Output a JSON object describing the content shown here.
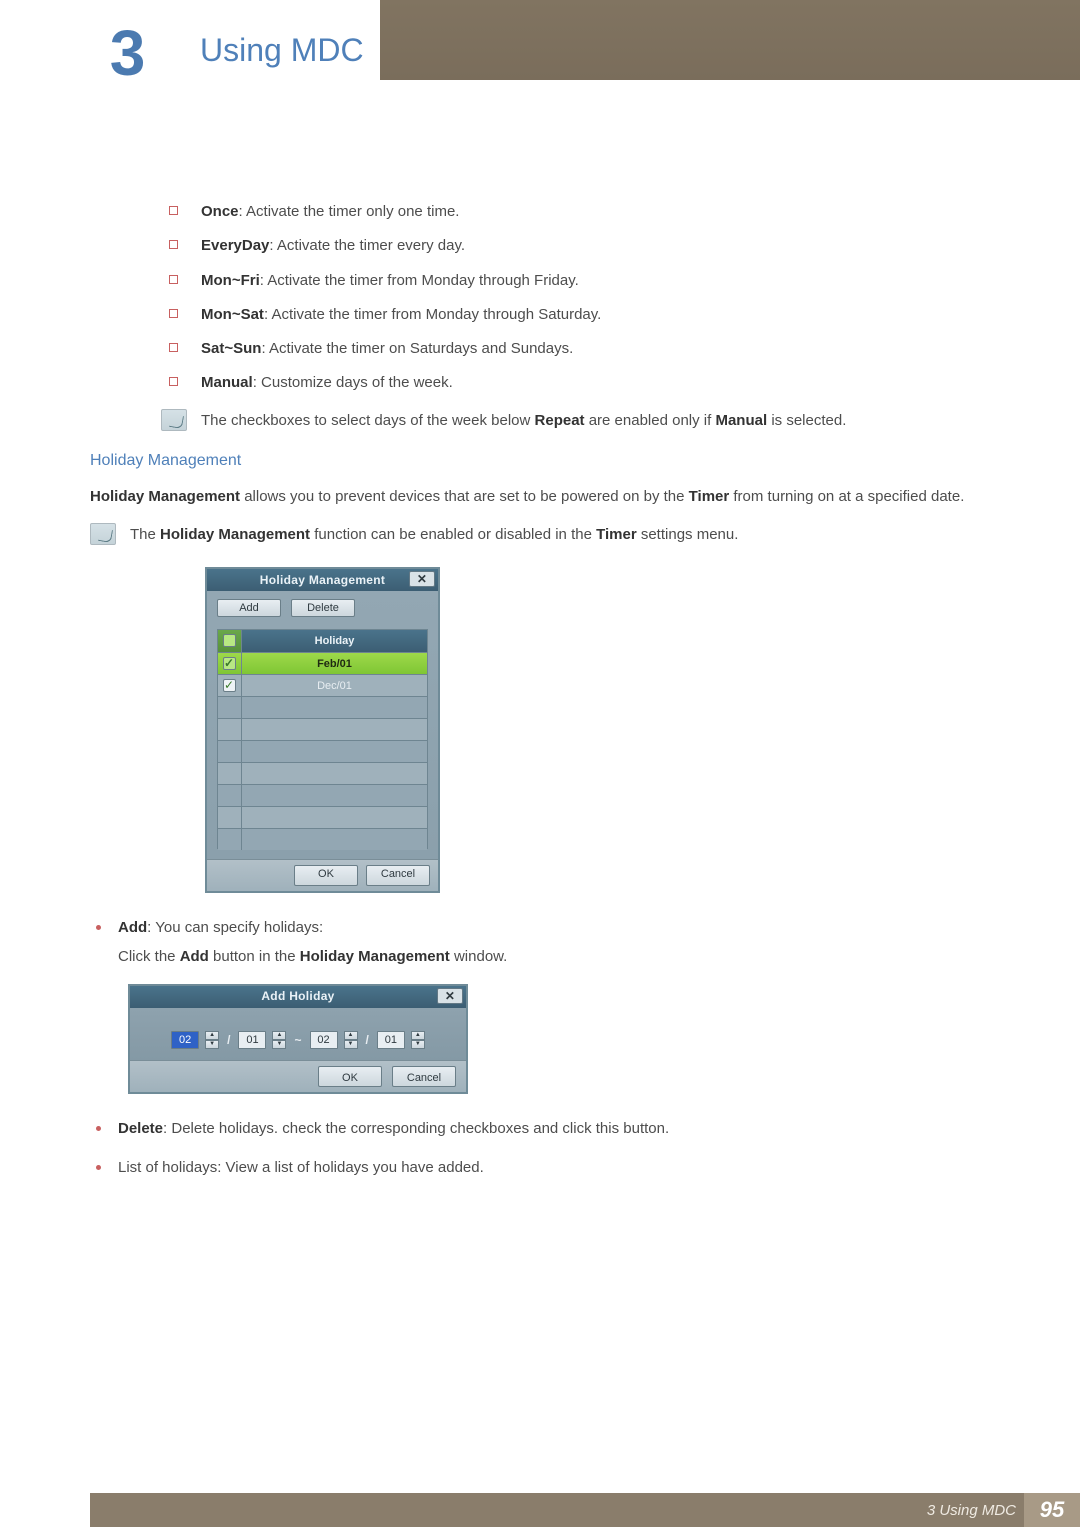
{
  "chapter_number": "3",
  "chapter_title": "Using MDC",
  "repeat_options": [
    {
      "name": "Once",
      "desc": ": Activate the timer only one time."
    },
    {
      "name": "EveryDay",
      "desc": ": Activate the timer every day."
    },
    {
      "name": "Mon~Fri",
      "desc": ": Activate the timer from Monday through Friday."
    },
    {
      "name": "Mon~Sat",
      "desc": ": Activate the timer from Monday through Saturday."
    },
    {
      "name": "Sat~Sun",
      "desc": ": Activate the timer on Saturdays and Sundays."
    },
    {
      "name": "Manual",
      "desc": ": Customize days of the week."
    }
  ],
  "note_repeat": {
    "pre": "The checkboxes to select days of the week below ",
    "b1": "Repeat",
    "mid": " are enabled only if ",
    "b2": "Manual",
    "post": " is selected."
  },
  "holiday_heading": "Holiday Management",
  "holiday_para": {
    "b1": "Holiday Management",
    "mid": " allows you to prevent devices that are set to be powered on by the ",
    "b2": "Timer",
    "post": " from turning on at a specified date."
  },
  "note_hm": {
    "pre": "The ",
    "b1": "Holiday Management",
    "mid": " function can be enabled or disabled in the ",
    "b2": "Timer",
    "post": " settings menu."
  },
  "hm_dialog": {
    "title": "Holiday Management",
    "add": "Add",
    "delete": "Delete",
    "col": "Holiday",
    "rows": [
      "Feb/01",
      "Dec/01"
    ],
    "ok": "OK",
    "cancel": "Cancel",
    "close": "✕"
  },
  "add_item": {
    "b": "Add",
    "desc": ": You can specify holidays:",
    "sub_pre": "Click the ",
    "sub_b1": "Add",
    "sub_mid": " button in the ",
    "sub_b2": "Holiday Management",
    "sub_post": " window."
  },
  "ah_dialog": {
    "title": "Add Holiday",
    "m1": "02",
    "d1": "01",
    "m2": "02",
    "d2": "01",
    "ok": "OK",
    "cancel": "Cancel",
    "close": "✕"
  },
  "delete_item": {
    "b": "Delete",
    "desc": ": Delete holidays. check the corresponding checkboxes and click this button."
  },
  "list_item": "List of holidays: View a list of holidays you have added.",
  "footer": {
    "label": "3 Using MDC",
    "page": "95"
  }
}
